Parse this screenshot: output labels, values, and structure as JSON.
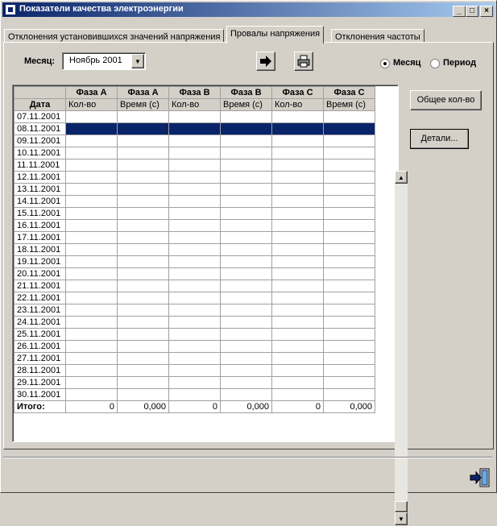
{
  "window": {
    "title": "Показатели качества электроэнергии",
    "min": "_",
    "max": "□",
    "close": "×"
  },
  "tabs": [
    {
      "label": "Отклонения установившихся значений напряжения",
      "active": false
    },
    {
      "label": "Провалы напряжения",
      "active": true
    },
    {
      "label": "Отклонения частоты",
      "active": false
    }
  ],
  "controls": {
    "month_label": "Месяц:",
    "month_value": "Ноябрь  2001",
    "radio_month": "Месяц",
    "radio_period": "Период"
  },
  "grid": {
    "headers": [
      "Фаза А",
      "Фаза А",
      "Фаза В",
      "Фаза В",
      "Фаза С",
      "Фаза С"
    ],
    "date_header": "Дата",
    "subheaders": [
      "Кол-во",
      "Время (с)",
      "Кол-во",
      "Время (с)",
      "Кол-во",
      "Время (с)"
    ],
    "dates": [
      "07.11.2001",
      "08.11.2001",
      "09.11.2001",
      "10.11.2001",
      "11.11.2001",
      "12.11.2001",
      "13.11.2001",
      "14.11.2001",
      "15.11.2001",
      "16.11.2001",
      "17.11.2001",
      "18.11.2001",
      "19.11.2001",
      "20.11.2001",
      "21.11.2001",
      "22.11.2001",
      "23.11.2001",
      "24.11.2001",
      "25.11.2001",
      "26.11.2001",
      "27.11.2001",
      "28.11.2001",
      "29.11.2001",
      "30.11.2001"
    ],
    "selected_date": "08.11.2001",
    "total_label": "Итого:",
    "totals": [
      "0",
      "0,000",
      "0",
      "0,000",
      "0",
      "0,000"
    ]
  },
  "buttons": {
    "total_count": "Общее кол-во",
    "details": "Детали..."
  }
}
